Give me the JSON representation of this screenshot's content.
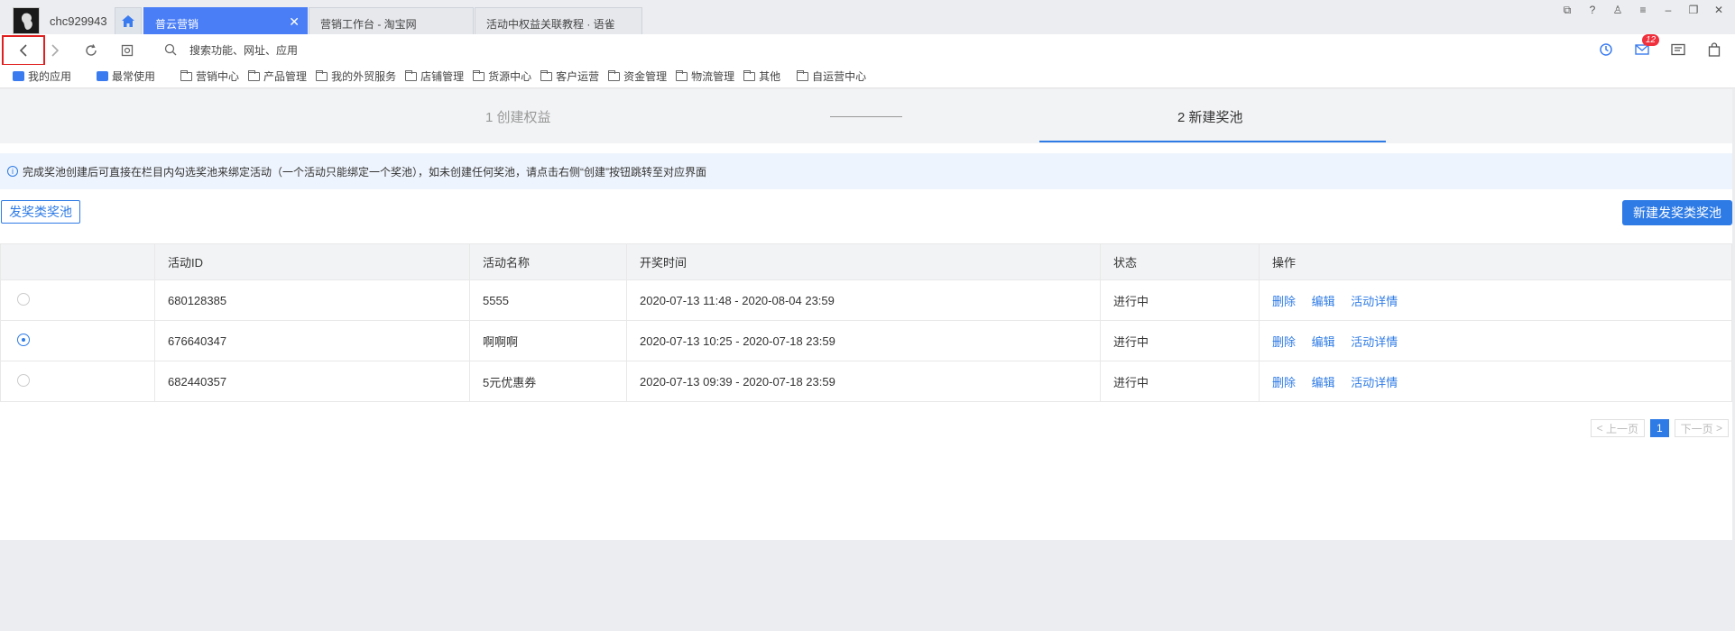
{
  "titlebar": {
    "username": "chc929943",
    "tabs": [
      {
        "label": "普云营销",
        "active": true
      },
      {
        "label": "营销工作台 - 淘宝网",
        "active": false
      },
      {
        "label": "活动中权益关联教程 · 语雀",
        "active": false
      }
    ]
  },
  "navbar": {
    "search_placeholder": "搜索功能、网址、应用",
    "mail_badge": "12"
  },
  "bookmarks": [
    "我的应用",
    "最常使用",
    "营销中心",
    "产品管理",
    "我的外贸服务",
    "店铺管理",
    "货源中心",
    "客户运营",
    "资金管理",
    "物流管理",
    "其他",
    "自运营中心"
  ],
  "steps": {
    "step1": "1 创建权益",
    "step2": "2 新建奖池"
  },
  "info": "完成奖池创建后可直接在栏目内勾选奖池来绑定活动（一个活动只能绑定一个奖池），如未创建任何奖池，请点击右侧“创建”按钮跳转至对应界面",
  "buttons": {
    "pool_type": "发奖类奖池",
    "new_pool": "新建发奖类奖池"
  },
  "table": {
    "headers": [
      "",
      "活动ID",
      "活动名称",
      "开奖时间",
      "状态",
      "操作"
    ],
    "rows": [
      {
        "id": "680128385",
        "name": "5555",
        "time": "2020-07-13 11:48 - 2020-08-04 23:59",
        "status": "进行中",
        "checked": false
      },
      {
        "id": "676640347",
        "name": "啊啊啊",
        "time": "2020-07-13 10:25 - 2020-07-18 23:59",
        "status": "进行中",
        "checked": true
      },
      {
        "id": "682440357",
        "name": "5元优惠券",
        "time": "2020-07-13 09:39 - 2020-07-18 23:59",
        "status": "进行中",
        "checked": false
      }
    ],
    "ops": [
      "删除",
      "编辑",
      "活动详情"
    ]
  },
  "pager": {
    "prev": "上一页",
    "current": "1",
    "next": "下一页"
  },
  "colors": {
    "accent": "#2e7be6",
    "tab_active": "#4a7ef7"
  }
}
